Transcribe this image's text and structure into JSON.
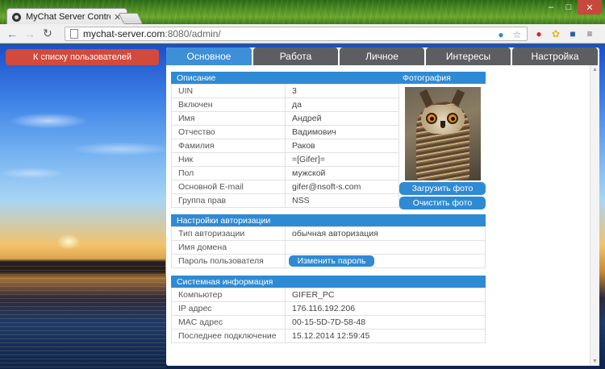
{
  "browser": {
    "tab_title": "MyChat Server Control Pa",
    "url_host": "mychat-server.com",
    "url_path": ":8080/admin/",
    "accent": "#4a8a22"
  },
  "page": {
    "back_button": "К списку пользователей",
    "tabs": [
      "Основное",
      "Работа",
      "Личное",
      "Интересы",
      "Настройка"
    ],
    "active_tab": "Основное"
  },
  "description": {
    "header": "Описание",
    "rows": [
      {
        "label": "UIN",
        "value": "3"
      },
      {
        "label": "Включен",
        "value": "да"
      },
      {
        "label": "Имя",
        "value": "Андрей"
      },
      {
        "label": "Отчество",
        "value": "Вадимович"
      },
      {
        "label": "Фамилия",
        "value": "Раков"
      },
      {
        "label": "Ник",
        "value": "=[Gifer]="
      },
      {
        "label": "Пол",
        "value": "мужской"
      },
      {
        "label": "Основной E-mail",
        "value": "gifer@nsoft-s.com"
      },
      {
        "label": "Группа прав",
        "value": "NSS"
      }
    ]
  },
  "photo": {
    "header": "Фотография",
    "upload_button": "Загрузить фото",
    "clear_button": "Очистить фото"
  },
  "auth": {
    "header": "Настройки авторизации",
    "rows": [
      {
        "label": "Тип авторизации",
        "value": "обычная авторизация"
      },
      {
        "label": "Имя домена",
        "value": ""
      },
      {
        "label": "Пароль пользователя",
        "value": ""
      }
    ],
    "change_password_button": "Изменить пароль"
  },
  "system": {
    "header": "Системная информация",
    "rows": [
      {
        "label": "Компьютер",
        "value": "GIFER_PC"
      },
      {
        "label": "IP адрес",
        "value": "176.116.192.206"
      },
      {
        "label": "MAC адрес",
        "value": "00-15-5D-7D-58-48"
      },
      {
        "label": "Последнее подключение",
        "value": "15.12.2014 12:59:45"
      }
    ]
  }
}
